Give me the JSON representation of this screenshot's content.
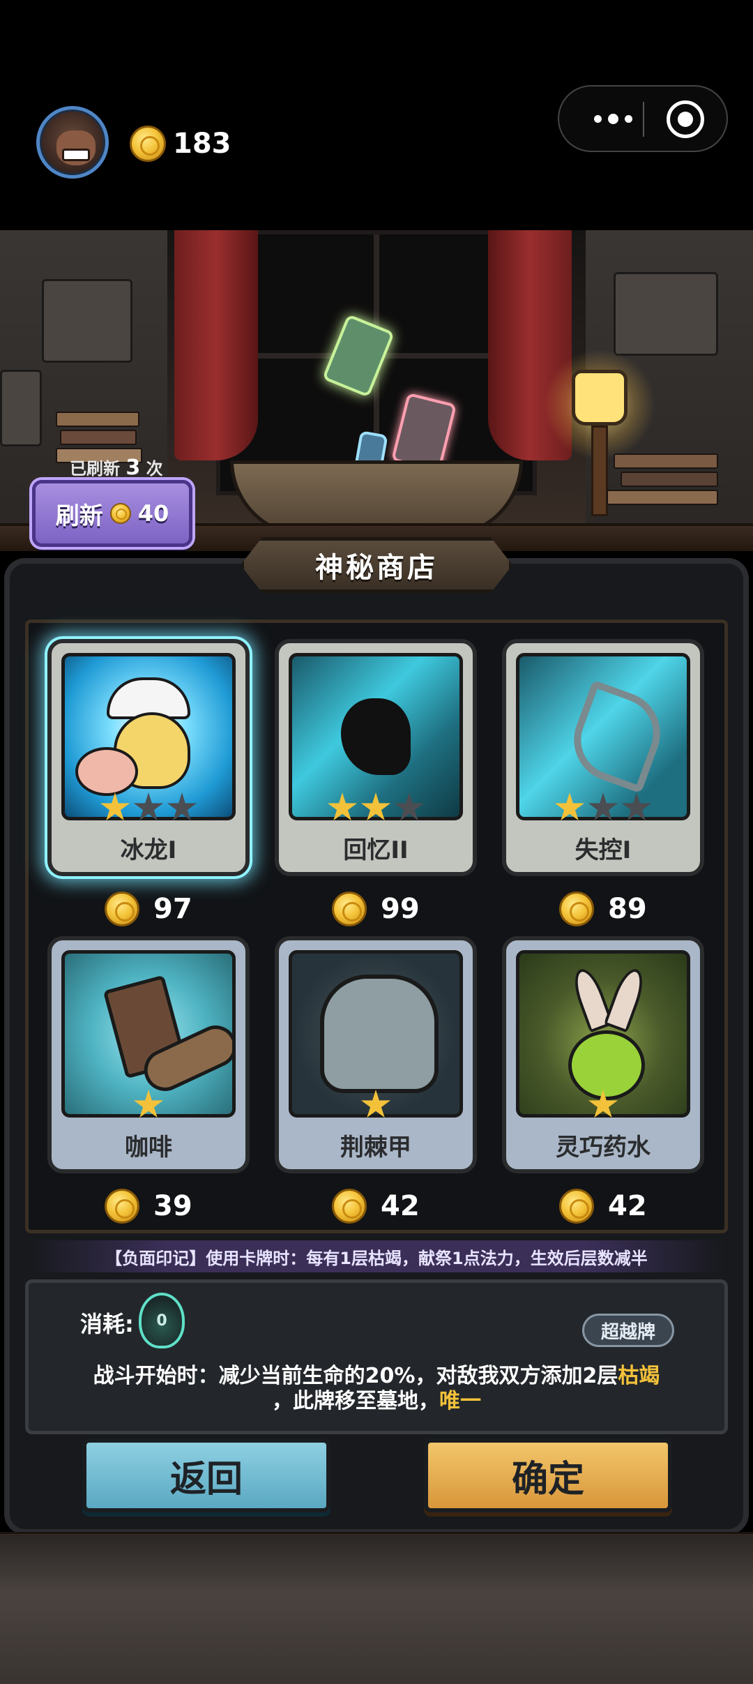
{
  "header": {
    "coins": "183"
  },
  "shop": {
    "refreshed_prefix": "已刷新",
    "refreshed_count": "3",
    "refreshed_suffix": "次",
    "refresh_label": "刷新",
    "refresh_cost": "40",
    "title": "神秘商店"
  },
  "cards": [
    {
      "name": "冰龙I",
      "price": "97",
      "stars": 1,
      "max_stars": 3,
      "selected": true
    },
    {
      "name": "回忆II",
      "price": "99",
      "stars": 2,
      "max_stars": 3,
      "selected": false
    },
    {
      "name": "失控I",
      "price": "89",
      "stars": 1,
      "max_stars": 3,
      "selected": false
    },
    {
      "name": "咖啡",
      "price": "39",
      "stars": 1,
      "max_stars": 1,
      "selected": false
    },
    {
      "name": "荆棘甲",
      "price": "42",
      "stars": 1,
      "max_stars": 1,
      "selected": false
    },
    {
      "name": "灵巧药水",
      "price": "42",
      "stars": 1,
      "max_stars": 1,
      "selected": false
    }
  ],
  "detail": {
    "mark_text": "【负面印记】使用卡牌时：每有1层枯竭，献祭1点法力，生效后层数减半",
    "cost_label": "消耗:",
    "cost_value": "0",
    "tag": "超越牌",
    "effect_line1_a": "战斗开始时：减少当前生命的20%，对敌我双方添加2层",
    "effect_line1_hl": "枯竭",
    "effect_line2_a": "，此牌移至墓地，",
    "effect_line2_hl": "唯一"
  },
  "buttons": {
    "back": "返回",
    "confirm": "确定"
  },
  "colors": {
    "gold": "#f3c23a",
    "refresh_purple": "#7d63c4",
    "back_blue": "#5aa8c2",
    "confirm_orange": "#d8963a",
    "selected_glow": "#8ff2ff"
  }
}
